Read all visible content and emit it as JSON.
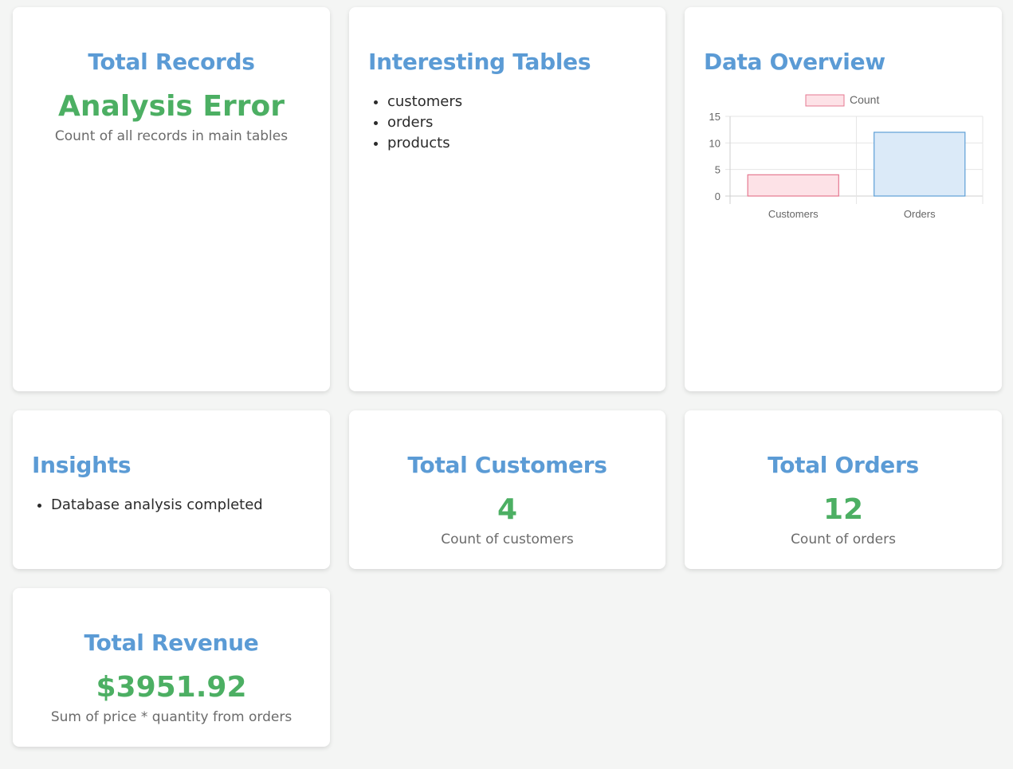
{
  "cards": {
    "total_records": {
      "title": "Total Records",
      "value": "Analysis Error",
      "desc": "Count of all records in main tables"
    },
    "interesting_tables": {
      "title": "Interesting Tables",
      "items": [
        "customers",
        "orders",
        "products"
      ]
    },
    "data_overview": {
      "title": "Data Overview"
    },
    "insights": {
      "title": "Insights",
      "items": [
        "Database analysis completed"
      ]
    },
    "total_customers": {
      "title": "Total Customers",
      "value": "4",
      "desc": "Count of customers"
    },
    "total_orders": {
      "title": "Total Orders",
      "value": "12",
      "desc": "Count of orders"
    },
    "total_revenue": {
      "title": "Total Revenue",
      "value": "$3951.92",
      "desc": "Sum of price * quantity from orders"
    }
  },
  "chart_data": {
    "type": "bar",
    "categories": [
      "Customers",
      "Orders"
    ],
    "series": [
      {
        "name": "Count",
        "values": [
          4,
          12
        ]
      }
    ],
    "ylim": [
      0,
      15
    ],
    "yticks": [
      0,
      5,
      10,
      15
    ],
    "grid": true,
    "legend": "top",
    "bar_fills": [
      "#fde2e7",
      "#dbeaf8"
    ],
    "bar_strokes": [
      "#e57890",
      "#5e9fd6"
    ]
  },
  "colors": {
    "title": "#5b9bd5",
    "value": "#4caf63",
    "desc": "#6b6b6b"
  }
}
